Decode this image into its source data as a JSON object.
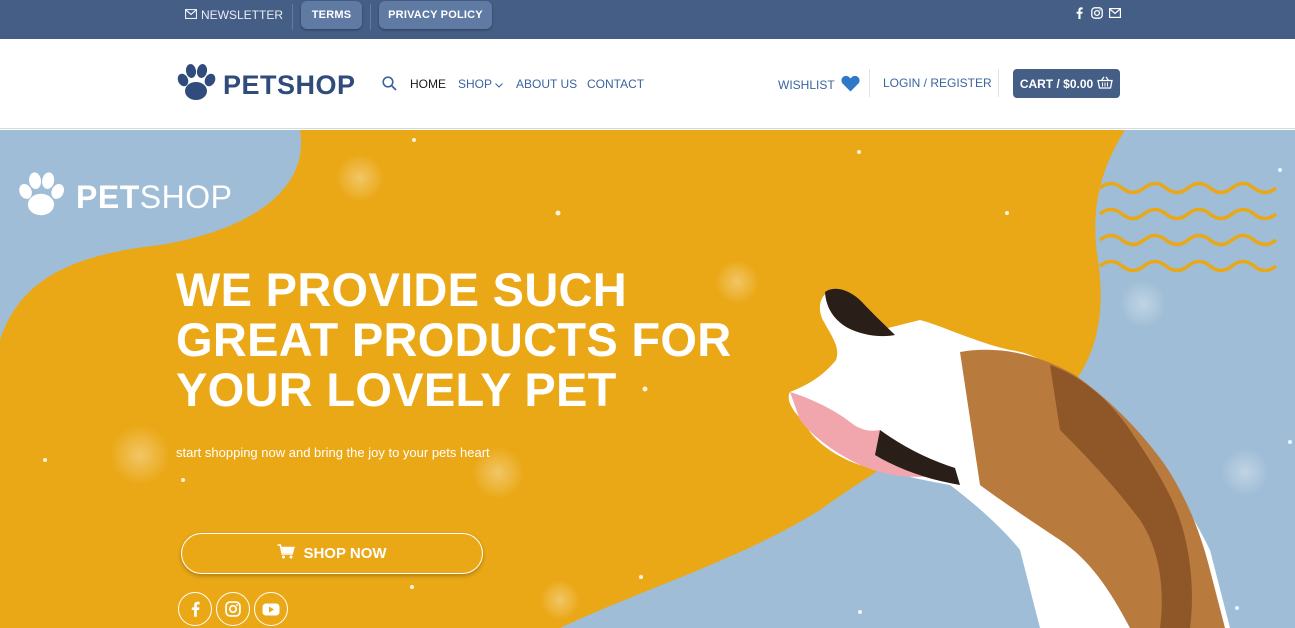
{
  "topbar": {
    "newsletter": "NEWSLETTER",
    "terms": "TERMS",
    "privacy": "PRIVACY POLICY",
    "social_icons": [
      "facebook-icon",
      "instagram-icon",
      "envelope-icon"
    ]
  },
  "header": {
    "logo_text_pet": "PET",
    "logo_text_shop": "SHOP",
    "nav": {
      "home": "HOME",
      "shop": "SHOP",
      "about": "ABOUT US",
      "contact": "CONTACT"
    },
    "wishlist": "WISHLIST",
    "login": "LOGIN / REGISTER",
    "cart": "CART / $0.00"
  },
  "hero": {
    "logo_text_pet": "PET",
    "logo_text_shop": "SHOP",
    "title": "WE PROVIDE SUCH GREAT PRODUCTS FOR YOUR LOVELY PET",
    "subtitle": "start shopping now and bring the joy to your pets heart",
    "cta": "SHOP NOW",
    "social_icons": [
      "facebook-icon",
      "instagram-icon",
      "youtube-icon"
    ]
  },
  "colors": {
    "topbar": "#455e85",
    "accent_blue": "#3a64a0",
    "hero_yellow": "#eaa816",
    "hero_blue": "#9fbdd6"
  }
}
